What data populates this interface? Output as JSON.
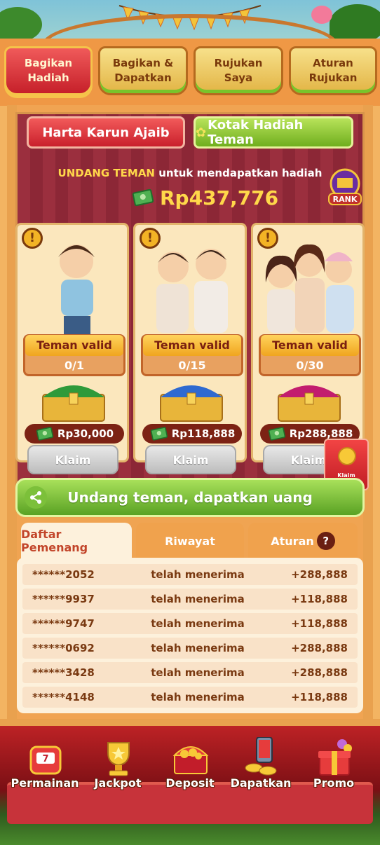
{
  "tabs": [
    {
      "label": "Bagikan\nHadiah",
      "active": true
    },
    {
      "label": "Bagikan &\nDapatkan",
      "active": false
    },
    {
      "label": "Rujukan\nSaya",
      "active": false
    },
    {
      "label": "Aturan\nRujukan",
      "active": false
    }
  ],
  "subtabs": {
    "harta": "Harta Karun Ajaib",
    "kotak": "Kotak Hadiah Teman"
  },
  "header": {
    "invite_highlight": "UNDANG TEMAN",
    "invite_rest": " untuk mendapatkan hadiah",
    "total": "Rp437,776",
    "rank": "RANK"
  },
  "cards": [
    {
      "valid_label": "Teman valid",
      "count": "0/1",
      "reward": "Rp30,000",
      "claim": "Klaim",
      "chest_color": "#2f9a3a"
    },
    {
      "valid_label": "Teman valid",
      "count": "0/15",
      "reward": "Rp118,888",
      "claim": "Klaim",
      "chest_color": "#2f6ad0"
    },
    {
      "valid_label": "Teman valid",
      "count": "0/30",
      "reward": "Rp288,888",
      "claim": "Klaim",
      "chest_color": "#c21d6e"
    }
  ],
  "amplop_label": "Klaim Amplop",
  "invite_button": "Undang teman, dapatkan uang",
  "list_tabs": {
    "daftar": "Daftar Pemenang",
    "riwayat": "Riwayat",
    "aturan": "Aturan",
    "help": "?"
  },
  "winners": [
    {
      "user": "******2052",
      "status": "telah menerima",
      "amount": "+288,888"
    },
    {
      "user": "******9937",
      "status": "telah menerima",
      "amount": "+118,888"
    },
    {
      "user": "******9747",
      "status": "telah menerima",
      "amount": "+118,888"
    },
    {
      "user": "******0692",
      "status": "telah menerima",
      "amount": "+288,888"
    },
    {
      "user": "******3428",
      "status": "telah menerima",
      "amount": "+288,888"
    },
    {
      "user": "******4148",
      "status": "telah menerima",
      "amount": "+118,888"
    }
  ],
  "nav": [
    {
      "label": "Permainan",
      "icon": "slot-machine-icon"
    },
    {
      "label": "Jackpot",
      "icon": "trophy-icon"
    },
    {
      "label": "Deposit",
      "icon": "treasure-chest-icon"
    },
    {
      "label": "Dapatkan",
      "icon": "phone-coins-icon"
    },
    {
      "label": "Promo",
      "icon": "gift-box-icon"
    }
  ],
  "colors": {
    "accent_red": "#c6202a",
    "accent_green": "#6fae1e",
    "gold": "#ffd84a"
  }
}
